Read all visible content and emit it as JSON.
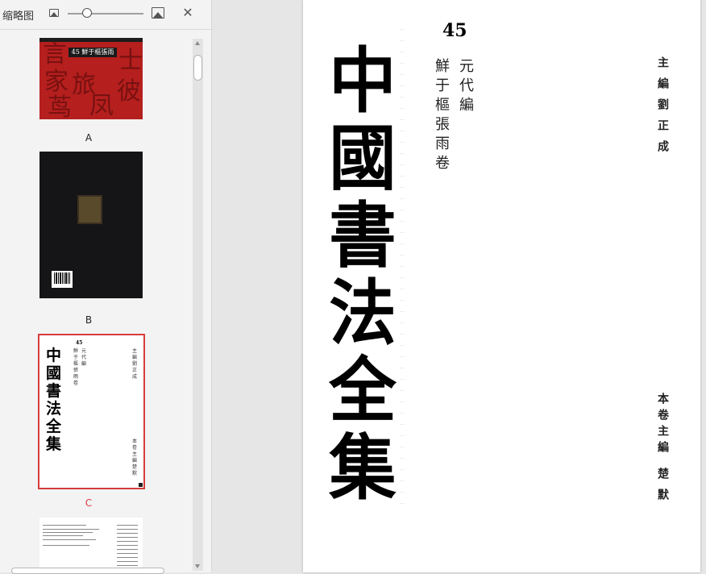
{
  "panel": {
    "title": "缩略图",
    "zoom_level": 0.25,
    "icons": {
      "small_image": "image-small-icon",
      "large_image": "image-large-icon",
      "close": "close-icon"
    },
    "close_glyph": "✕"
  },
  "thumbnails": [
    {
      "label": "A",
      "banner_num": "45",
      "banner_text": "鮮于樞張雨",
      "brush_glyphs": [
        "言",
        "士",
        "家",
        "旅",
        "茑",
        "凤",
        "彼"
      ]
    },
    {
      "label": "B"
    },
    {
      "label": "C",
      "selected": true,
      "mini_num": "45",
      "mini_title": "中國書法全集",
      "mini_era": "元代編",
      "mini_names": "鮮于樞張雨卷",
      "mini_editor": "主編劉正成",
      "mini_vol_editor": "本卷主編楚默"
    },
    {
      "label": ""
    }
  ],
  "document": {
    "volume_number": "45",
    "title_chars": [
      "中",
      "國",
      "書",
      "法",
      "全",
      "集"
    ],
    "era": "元代編",
    "volume_name": "鮮于樞張雨卷",
    "chief_editor": "主編劉正成",
    "volume_editor_title": "本卷主編",
    "volume_editor_name": "楚默"
  },
  "colors": {
    "selection": "#d83b3b",
    "cover_red": "#b51f1e",
    "back_black": "#151517"
  }
}
